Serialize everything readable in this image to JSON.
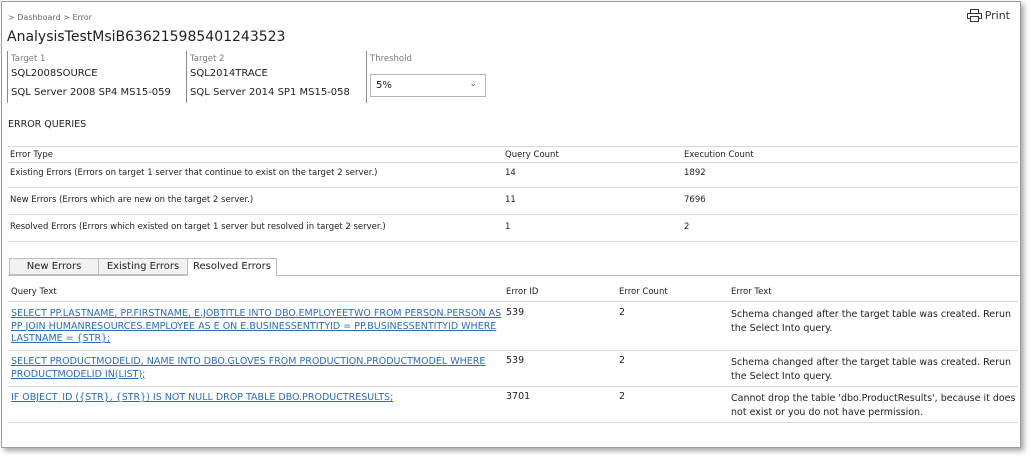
{
  "breadcrumb": "> Dashboard > Error",
  "print_label": "Print",
  "title": "AnalysisTestMsiB636215985401243523",
  "target1": {
    "label": "Target 1",
    "server": "SQL2008SOURCE",
    "version": "SQL Server 2008 SP4 MS15-059"
  },
  "target2": {
    "label": "Target 2",
    "server": "SQL2014TRACE",
    "version": "SQL Server 2014 SP1 MS15-058"
  },
  "threshold": {
    "label": "Threshold",
    "value": "5%"
  },
  "error_queries": {
    "title": "ERROR QUERIES",
    "headers": [
      "Error Type",
      "Query Count",
      "Execution Count"
    ],
    "rows": [
      [
        "Existing Errors (Errors on target 1 server that continue to exist on the target 2 server.)",
        "14",
        "1892"
      ],
      [
        "New Errors (Errors which are new on the target 2 server.)",
        "11",
        "7696"
      ],
      [
        "Resolved Errors (Errors which existed on target 1 server but resolved in target 2 server.)",
        "1",
        "2"
      ]
    ]
  },
  "tabs": [
    "New Errors",
    "Existing Errors",
    "Resolved Errors"
  ],
  "active_tab": "Resolved Errors",
  "resolved": {
    "headers": [
      "Query Text",
      "Error ID",
      "Error Count",
      "Error Text"
    ],
    "rows": [
      {
        "query": "SELECT PP.LASTNAME, PP.FIRSTNAME, E.JOBTITLE INTO DBO.EMPLOYEETWO FROM PERSON.PERSON AS PP JOIN HUMANRESOURCES.EMPLOYEE AS E ON E.BUSINESSENTITYID = PP.BUSINESSENTITYID WHERE LASTNAME = {STR};",
        "error_id": "539",
        "error_count": "2",
        "error_text": "Schema changed after the target table was created. Rerun the Select Into query."
      },
      {
        "query": "SELECT PRODUCTMODELID, NAME INTO DBO.GLOVES FROM PRODUCTION.PRODUCTMODEL WHERE PRODUCTMODELID IN(LIST);",
        "error_id": "539",
        "error_count": "2",
        "error_text": "Schema changed after the target table was created. Rerun the Select Into query."
      },
      {
        "query": "IF OBJECT_ID ({STR}, {STR}) IS NOT NULL DROP TABLE DBO.PRODUCTRESULTS;",
        "error_id": "3701",
        "error_count": "2",
        "error_text": "Cannot drop the table 'dbo.ProductResults', because it does not exist or you do not have permission."
      }
    ]
  },
  "colors": {
    "link": "#2a6cc0",
    "border": "#9a9a9a",
    "grid": "#d9d9d9"
  },
  "icons": {
    "print": "printer-icon",
    "dropdown": "chevron-down-icon"
  }
}
